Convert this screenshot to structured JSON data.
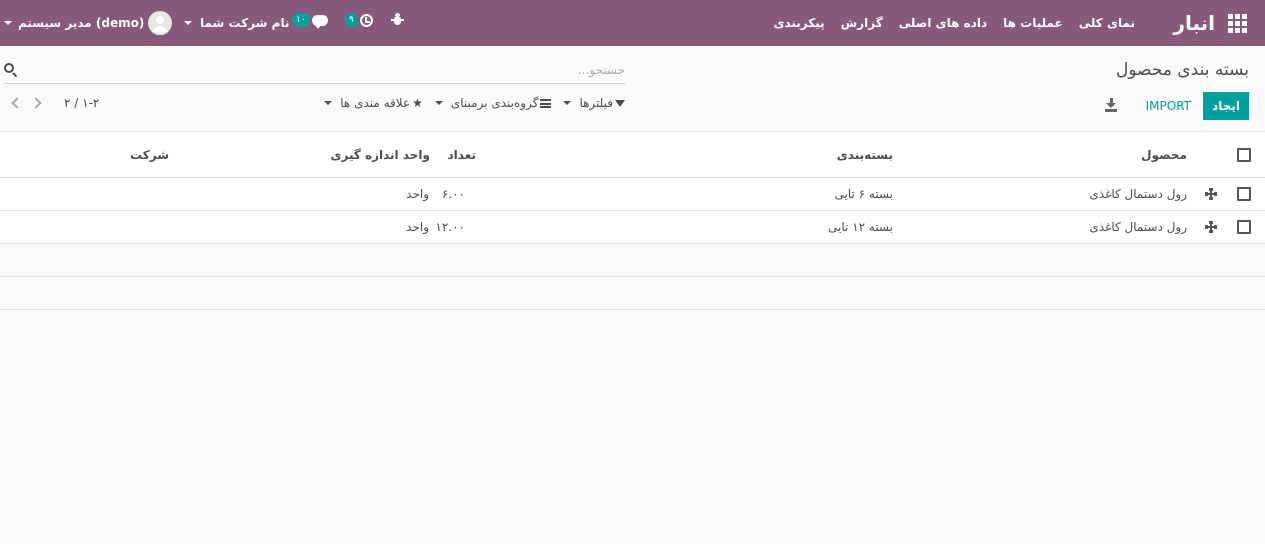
{
  "navbar": {
    "app_name": "انبار",
    "menu": [
      "نمای کلی",
      "عملیات ها",
      "داده های اصلی",
      "گزارش",
      "پیکربندی"
    ],
    "company": "نام شرکت شما",
    "user": "مدیر سیستم (demo)",
    "messages_count": "۱۰",
    "activities_count": "۹",
    "colors": {
      "bar": "#875a7b",
      "accent": "#00a09d"
    },
    "icons": [
      "apps-grid-icon",
      "chat-icon",
      "clock-icon",
      "bug-icon",
      "avatar"
    ]
  },
  "control_panel": {
    "title": "بسته بندی محصول",
    "search_placeholder": "جستجو...",
    "create_label": "ایجاد",
    "import_label": "IMPORT",
    "filters_label": "فیلترها",
    "groupby_label": "گروه‌بندی برمبنای",
    "favorites_label": "علاقه مندی ها",
    "pager_value": "۱-۲ / ۲"
  },
  "table": {
    "columns": {
      "product": "محصول",
      "package": "بسته‌بندی",
      "qty": "تعداد",
      "uom": "واحد اندازه گیری",
      "company": "شرکت"
    },
    "rows": [
      {
        "product": "رول دستمال کاغذی",
        "package": "بسته ۶ تایی",
        "qty": "۶.۰۰",
        "uom": "واحد",
        "company": ""
      },
      {
        "product": "رول دستمال کاغذی",
        "package": "بسته ۱۲ تایی",
        "qty": "۱۲.۰۰",
        "uom": "واحد",
        "company": ""
      }
    ]
  }
}
